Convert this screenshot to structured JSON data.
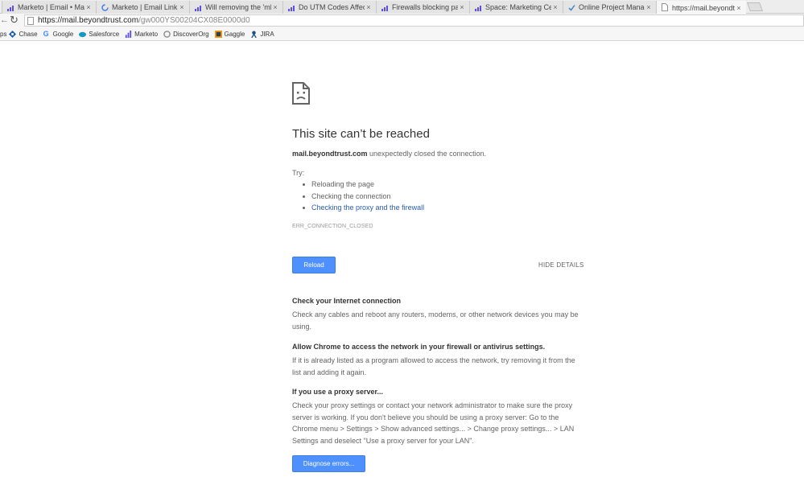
{
  "tabs": [
    {
      "title": "Marketo | Email • Marketo",
      "icon": "marketo-icon",
      "active": false
    },
    {
      "title": "Marketo | Email Link Perfo",
      "icon": "loading-spinner-icon",
      "active": false
    },
    {
      "title": "Will removing the 'mktNo",
      "icon": "marketo-icon",
      "active": false
    },
    {
      "title": "Do UTM Codes Affect Link",
      "icon": "marketo-icon",
      "active": false
    },
    {
      "title": "Firewalls blocking pages o",
      "icon": "marketo-icon",
      "active": false
    },
    {
      "title": "Space: Marketing Central",
      "icon": "marketo-icon",
      "active": false
    },
    {
      "title": "Online Project Manageme",
      "icon": "checkmark-icon",
      "active": false
    },
    {
      "title": "https://mail.beyondtrust.c",
      "icon": "page-icon",
      "active": true
    }
  ],
  "tab_close_glyph": "×",
  "toolbar": {
    "url_host": "https://mail.beyondtrust.com",
    "url_path": "/gw000YS00204CX08E0000d0"
  },
  "bookmarks": [
    {
      "label": "Chase",
      "icon": "chase-icon"
    },
    {
      "label": "Google",
      "icon": "google-icon"
    },
    {
      "label": "Salesforce",
      "icon": "salesforce-icon"
    },
    {
      "label": "Marketo",
      "icon": "marketo-icon"
    },
    {
      "label": "DiscoverOrg",
      "icon": "discoverorg-icon"
    },
    {
      "label": "Gaggle",
      "icon": "gaggle-icon"
    },
    {
      "label": "JIRA",
      "icon": "jira-icon"
    }
  ],
  "bookmarks_prefix": "ps",
  "error": {
    "headline": "This site can’t be reached",
    "host": "mail.beyondtrust.com",
    "desc_rest": " unexpectedly closed the connection.",
    "try_label": "Try:",
    "suggestions": [
      "Reloading the page",
      "Checking the connection",
      "Checking the proxy and the firewall"
    ],
    "code": "ERR_CONNECTION_CLOSED",
    "reload_label": "Reload",
    "hide_details_label": "HIDE DETAILS"
  },
  "details": {
    "sections": [
      {
        "title": "Check your Internet connection",
        "body": "Check any cables and reboot any routers, modems, or other network devices you may be using."
      },
      {
        "title": "Allow Chrome to access the network in your firewall or antivirus settings.",
        "body": "If it is already listed as a program allowed to access the network, try removing it from the list and adding it again."
      },
      {
        "title": "If you use a proxy server...",
        "body": "Check your proxy settings or contact your network administrator to make sure the proxy server is working. If you don't believe you should be using a proxy server: Go to the Chrome menu > Settings > Show advanced settings... > Change proxy settings... > LAN Settings and deselect \"Use a proxy server for your LAN\"."
      }
    ],
    "diagnose_label": "Diagnose errors..."
  },
  "colors": {
    "accent": "#4d90fe",
    "link": "#2a5db0"
  }
}
